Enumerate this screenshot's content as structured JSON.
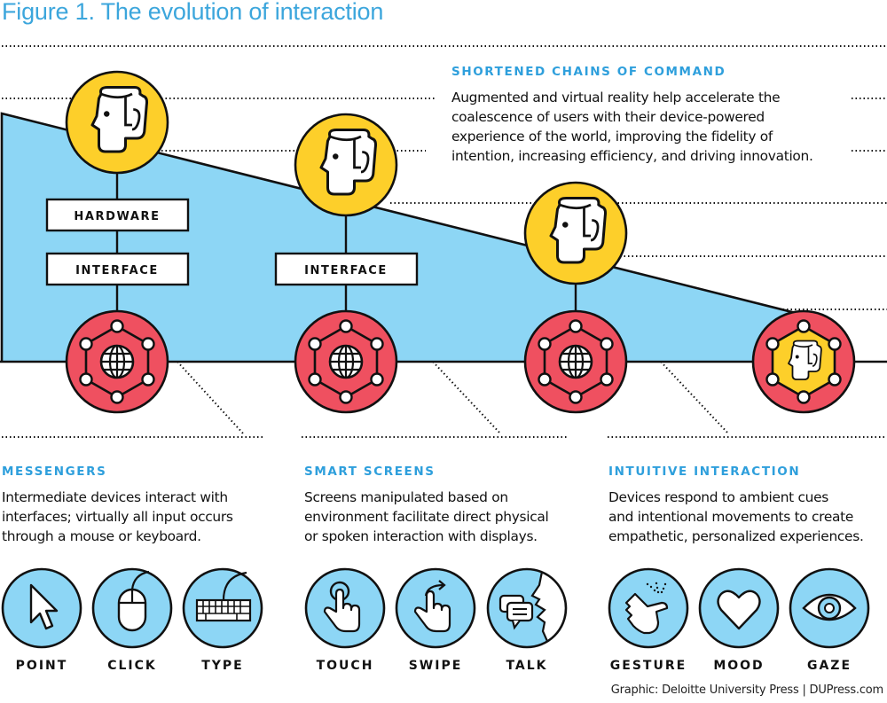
{
  "figure": {
    "title": "Figure 1. The evolution of interaction",
    "credit": "Graphic: Deloitte University Press  |  DUPress.com"
  },
  "colors": {
    "title_blue": "#3ca6dc",
    "heading_blue": "#2e9fdc",
    "wedge_blue": "#8dd6f5",
    "head_yellow": "#fdcf2a",
    "device_red": "#ef5060",
    "stroke": "#111111",
    "white": "#ffffff"
  },
  "top_note": {
    "heading": "SHORTENED CHAINS OF COMMAND",
    "body_lines": [
      "Augmented and virtual reality help accelerate the",
      "coalescence of users with their device-powered",
      "experience of the world, improving the fidelity of",
      "intention, increasing efficiency, and driving innovation."
    ]
  },
  "stages": [
    {
      "id": "messengers",
      "layers": [
        "HARDWARE",
        "INTERFACE"
      ],
      "user_icon": "human-head-icon",
      "device_icon": "network-globe-icon",
      "heading": "MESSENGERS",
      "body_lines": [
        "Intermediate devices interact with",
        "interfaces; virtually all input occurs",
        "through a mouse or keyboard."
      ],
      "modes": [
        {
          "label": "POINT",
          "icon": "cursor-arrow-icon"
        },
        {
          "label": "CLICK",
          "icon": "mouse-icon"
        },
        {
          "label": "TYPE",
          "icon": "keyboard-icon"
        }
      ]
    },
    {
      "id": "smart-screens",
      "layers": [
        "INTERFACE"
      ],
      "user_icon": "human-head-icon",
      "device_icon": "network-globe-icon",
      "heading": "SMART SCREENS",
      "body_lines": [
        "Screens manipulated based on",
        "environment facilitate direct physical",
        "or spoken interaction with displays."
      ],
      "modes": [
        {
          "label": "TOUCH",
          "icon": "touch-hand-icon"
        },
        {
          "label": "SWIPE",
          "icon": "swipe-hand-icon"
        },
        {
          "label": "TALK",
          "icon": "speech-bubbles-icon"
        }
      ]
    },
    {
      "id": "intuitive-interaction",
      "layers": [],
      "user_icon": "human-head-icon",
      "device_icon": "network-globe-icon",
      "heading": "INTUITIVE INTERACTION",
      "body_lines": [
        "Devices respond to ambient cues",
        "and intentional movements to create",
        "empathetic, personalized experiences."
      ],
      "modes": [
        {
          "label": "GESTURE",
          "icon": "snap-gesture-icon"
        },
        {
          "label": "MOOD",
          "icon": "heart-icon"
        },
        {
          "label": "GAZE",
          "icon": "eye-icon"
        }
      ]
    },
    {
      "id": "merged",
      "layers": [],
      "device_icon": "network-head-icon"
    }
  ]
}
